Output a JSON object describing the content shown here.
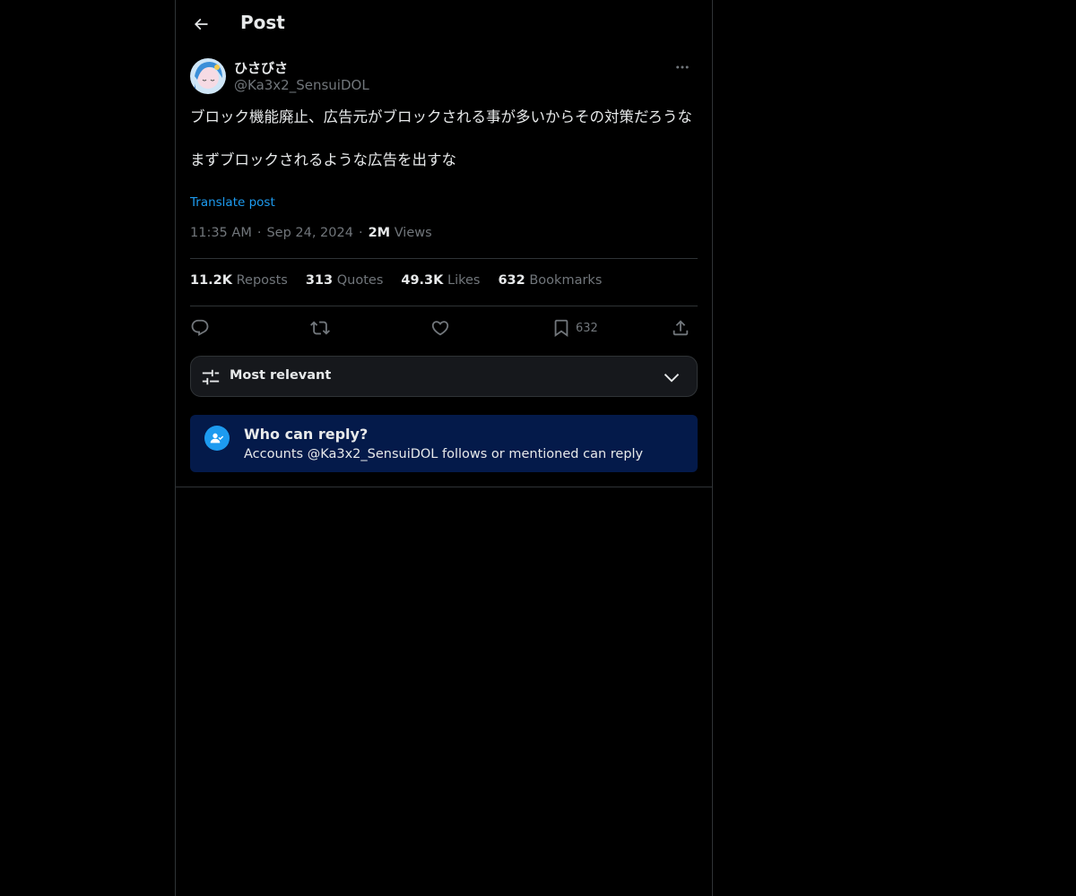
{
  "header": {
    "title": "Post",
    "back_icon": "arrow-left-icon"
  },
  "author": {
    "display_name": "ひさびさ",
    "handle": "@Ka3x2_SensuiDOL",
    "more_icon": "more-horizontal-icon"
  },
  "post": {
    "text": "ブロック機能廃止、広告元がブロックされる事が多いからその対策だろうな\n\nまずブロックされるような広告を出すな",
    "translate_label": "Translate post",
    "time": "11:35 AM",
    "date": "Sep 24, 2024",
    "views_count": "2M",
    "views_label": "Views"
  },
  "stats": {
    "reposts_count": "11.2K",
    "reposts_label": "Reposts",
    "quotes_count": "313",
    "quotes_label": "Quotes",
    "likes_count": "49.3K",
    "likes_label": "Likes",
    "bookmarks_count": "632",
    "bookmarks_label": "Bookmarks"
  },
  "actions": {
    "reply_icon": "reply-icon",
    "repost_icon": "repost-icon",
    "like_icon": "heart-icon",
    "bookmark_icon": "bookmark-icon",
    "bookmark_count": "632",
    "share_icon": "share-icon"
  },
  "sort": {
    "label": "Most relevant",
    "icon": "sliders-icon",
    "chevron": "chevron-down-icon"
  },
  "reply_restriction": {
    "title": "Who can reply?",
    "description": "Accounts @Ka3x2_SensuiDOL follows or mentioned can reply",
    "icon": "user-check-icon"
  },
  "colors": {
    "background": "#000000",
    "accent": "#1d9bf0",
    "text_primary": "#e7e9ea",
    "text_secondary": "#71767b",
    "border": "#2f3336",
    "reply_box": "#041a4a"
  }
}
